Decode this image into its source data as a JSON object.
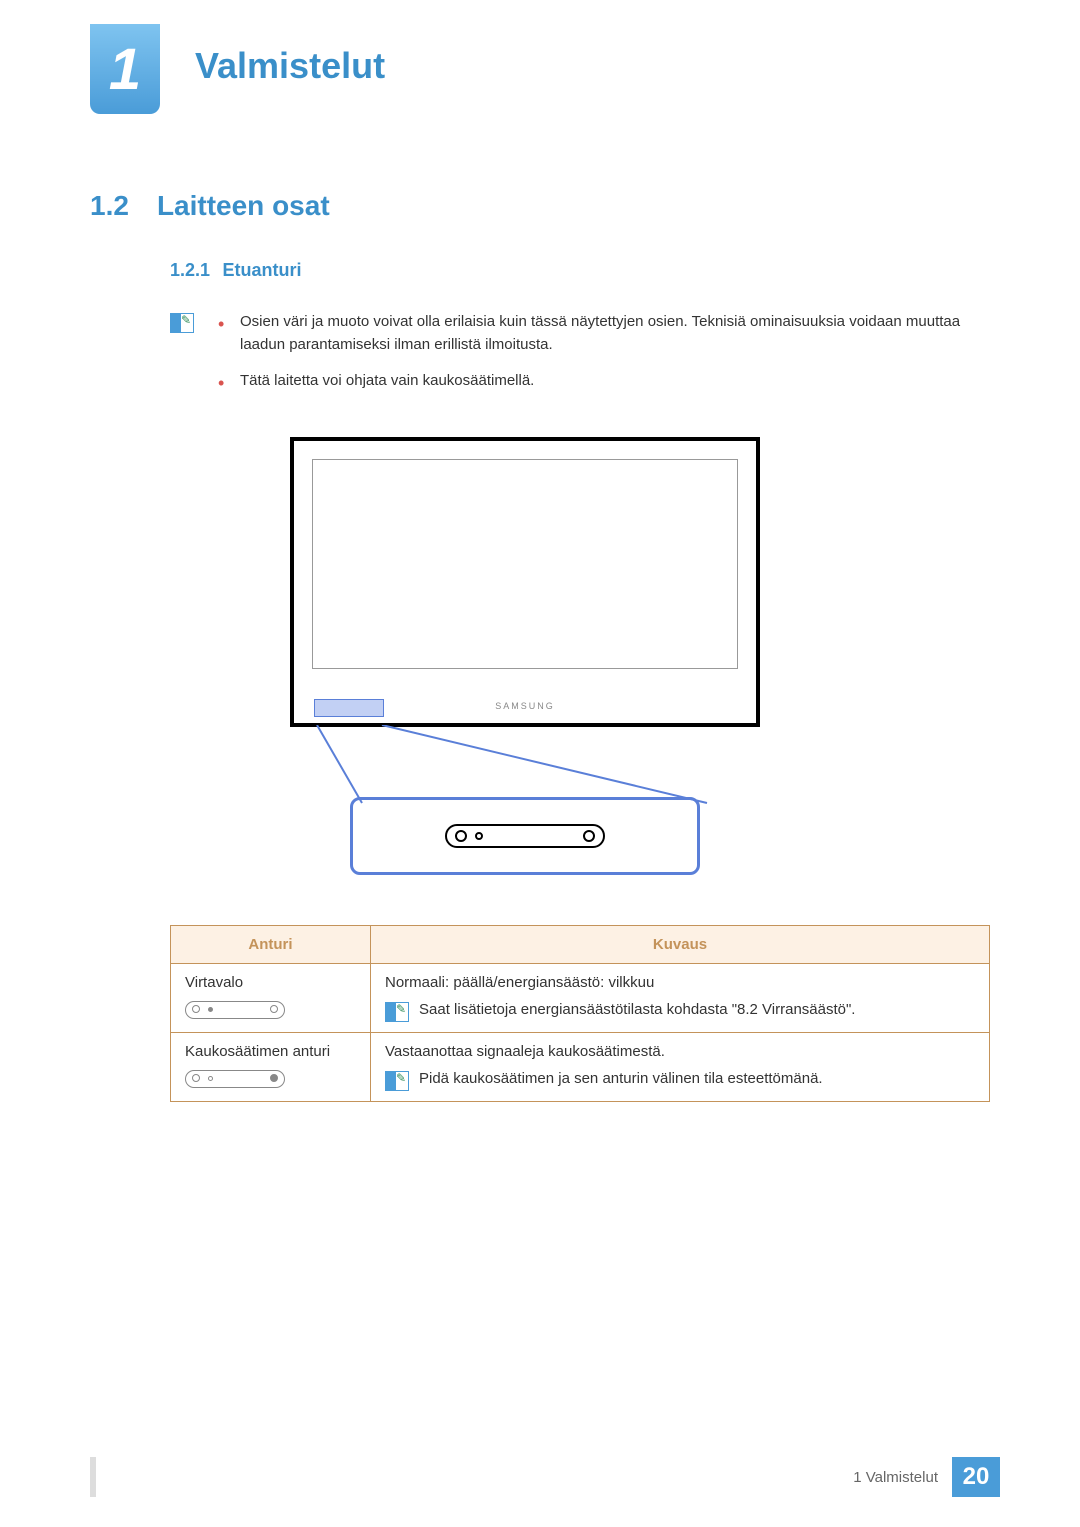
{
  "chapter": {
    "number": "1",
    "title": "Valmistelut"
  },
  "section": {
    "number": "1.2",
    "title": "Laitteen osat"
  },
  "subsection": {
    "number": "1.2.1",
    "title": "Etuanturi"
  },
  "notes": {
    "bullet1": "Osien väri ja muoto voivat olla erilaisia kuin tässä näytettyjen osien. Teknisiä ominaisuuksia voidaan muuttaa laadun parantamiseksi ilman erillistä ilmoitusta.",
    "bullet2": "Tätä laitetta voi ohjata vain kaukosäätimellä."
  },
  "figure": {
    "brand": "SAMSUNG"
  },
  "table": {
    "headers": {
      "sensor": "Anturi",
      "description": "Kuvaus"
    },
    "rows": [
      {
        "sensor": "Virtavalo",
        "desc_main": "Normaali: päällä/energiansäästö: vilkkuu",
        "desc_note": "Saat lisätietoja energiansäästötilasta kohdasta \"8.2 Virransäästö\"."
      },
      {
        "sensor": "Kaukosäätimen anturi",
        "desc_main": "Vastaanottaa signaaleja kaukosäätimestä.",
        "desc_note": "Pidä kaukosäätimen ja sen anturin välinen tila esteettömänä."
      }
    ]
  },
  "footer": {
    "text": "1 Valmistelut",
    "page": "20"
  }
}
